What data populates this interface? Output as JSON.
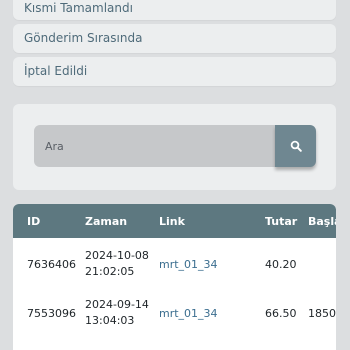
{
  "filters": [
    {
      "label": "Kısmi Tamamlandı"
    },
    {
      "label": "Gönderim Sırasında"
    },
    {
      "label": "İptal Edildi"
    }
  ],
  "search": {
    "placeholder": "Ara",
    "button_icon": "search-icon"
  },
  "table": {
    "columns": [
      "ID",
      "Zaman",
      "Link",
      "Tutar",
      "Başlan"
    ],
    "rows": [
      {
        "id": "7636406",
        "date": "2024-10-08",
        "time": "21:02:05",
        "link": "mrt_01_34",
        "amount": "40.20",
        "start": ""
      },
      {
        "id": "7553096",
        "date": "2024-09-14",
        "time": "13:04:03",
        "link": "mrt_01_34",
        "amount": "66.50",
        "start": "1850"
      }
    ]
  },
  "colors": {
    "background": "#dcdee0",
    "card": "#eceeef",
    "header": "#5d7880",
    "search_button": "#6f8791",
    "filter_text": "#4f6b7a"
  }
}
